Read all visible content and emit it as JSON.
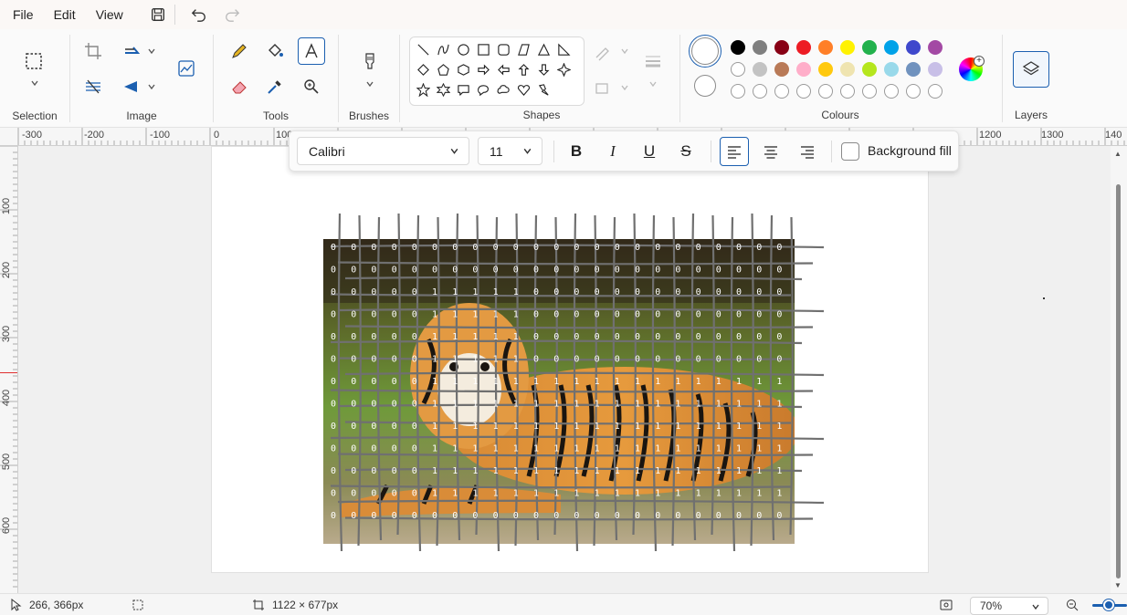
{
  "menu": {
    "file": "File",
    "edit": "Edit",
    "view": "View"
  },
  "ribbon": {
    "groups": {
      "selection": "Selection",
      "image": "Image",
      "tools": "Tools",
      "brushes": "Brushes",
      "shapes": "Shapes",
      "colours": "Colours",
      "layers": "Layers"
    },
    "palette": {
      "row1": [
        "#000000",
        "#7f7f7f",
        "#880015",
        "#ed1c24",
        "#ff7f27",
        "#fff200",
        "#22b14c",
        "#00a2e8",
        "#3f48cc",
        "#a349a4"
      ],
      "row2": [
        "#ffffff",
        "#c3c3c3",
        "#b97a57",
        "#ffaec9",
        "#ffc90e",
        "#efe4b0",
        "#b5e61d",
        "#99d9ea",
        "#7092be",
        "#c8bfe7"
      ]
    }
  },
  "rulers": {
    "top": [
      "-300",
      "-200",
      "-100",
      "0",
      "100",
      "1200",
      "1300",
      "140"
    ],
    "left": [
      "100",
      "200",
      "300",
      "400",
      "500",
      "600"
    ]
  },
  "textbar": {
    "font": "Calibri",
    "size": "11",
    "bold": "B",
    "italic": "I",
    "underline": "U",
    "strike": "S",
    "background_fill": "Background fill"
  },
  "status": {
    "cursor": "266, 366px",
    "selection_size": "",
    "canvas_size": "1122 × 677px",
    "zoom": "70%"
  }
}
